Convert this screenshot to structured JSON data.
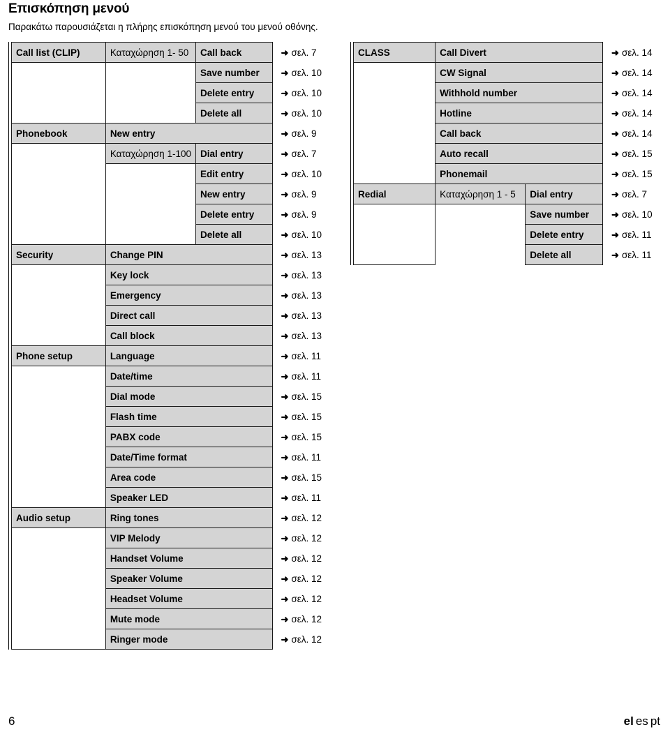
{
  "header": {
    "title": "Επισκόπηση μενού",
    "subtitle": "Παρακάτω παρουσιάζεται η πλήρης επισκόπηση μενού του μενού οθόνης."
  },
  "ref_prefix": "σελ.",
  "arrow_glyph": "➜",
  "colors": {
    "cell_fill": "#d4d4d4",
    "cell_border": "#1a1a1a",
    "text": "#000000",
    "page_bg": "#ffffff"
  },
  "left_table": {
    "rows": [
      {
        "c1": "Call list (CLIP)",
        "c2": "Καταχώρηση 1- 50",
        "c2_style": "reg",
        "c3": "Call back",
        "ref": "7"
      },
      {
        "c1": "",
        "c2": "",
        "c3": "Save number",
        "ref": "10"
      },
      {
        "c1": "",
        "c2": "",
        "c3": "Delete entry",
        "ref": "10"
      },
      {
        "c1": "",
        "c2": "",
        "c3": "Delete all",
        "ref": "10"
      },
      {
        "c1": "Phonebook",
        "c2": "New entry",
        "c2_span": 2,
        "ref": "9"
      },
      {
        "c1": "",
        "c2": "Καταχώρηση 1-100",
        "c2_style": "reg",
        "c3": "Dial entry",
        "ref": "7"
      },
      {
        "c1": "",
        "c2": "",
        "c3": "Edit entry",
        "ref": "10"
      },
      {
        "c1": "",
        "c2": "",
        "c3": "New entry",
        "ref": "9"
      },
      {
        "c1": "",
        "c2": "",
        "c3": "Delete entry",
        "ref": "9"
      },
      {
        "c1": "",
        "c2": "",
        "c3": "Delete all",
        "ref": "10"
      },
      {
        "c1": "Security",
        "c2": "Change PIN",
        "c2_span": 2,
        "ref": "13"
      },
      {
        "c1": "",
        "c2": "Key lock",
        "c2_span": 2,
        "ref": "13"
      },
      {
        "c1": "",
        "c2": "Emergency",
        "c2_span": 2,
        "ref": "13"
      },
      {
        "c1": "",
        "c2": "Direct call",
        "c2_span": 2,
        "ref": "13"
      },
      {
        "c1": "",
        "c2": "Call block",
        "c2_span": 2,
        "ref": "13"
      },
      {
        "c1": "Phone setup",
        "c2": "Language",
        "c2_span": 2,
        "ref": "11"
      },
      {
        "c1": "",
        "c2": "Date/time",
        "c2_span": 2,
        "ref": "11"
      },
      {
        "c1": "",
        "c2": "Dial mode",
        "c2_span": 2,
        "ref": "15"
      },
      {
        "c1": "",
        "c2": "Flash time",
        "c2_span": 2,
        "ref": "15"
      },
      {
        "c1": "",
        "c2": "PABX code",
        "c2_span": 2,
        "ref": "15"
      },
      {
        "c1": "",
        "c2": "Date/Time format",
        "c2_span": 2,
        "ref": "11"
      },
      {
        "c1": "",
        "c2": "Area code",
        "c2_span": 2,
        "ref": "15"
      },
      {
        "c1": "",
        "c2": "Speaker LED",
        "c2_span": 2,
        "ref": "11"
      },
      {
        "c1": "Audio setup",
        "c2": "Ring tones",
        "c2_span": 2,
        "ref": "12"
      },
      {
        "c1": "",
        "c2": "VIP Melody",
        "c2_span": 2,
        "ref": "12"
      },
      {
        "c1": "",
        "c2": "Handset Volume",
        "c2_span": 2,
        "ref": "12"
      },
      {
        "c1": "",
        "c2": "Speaker Volume",
        "c2_span": 2,
        "ref": "12"
      },
      {
        "c1": "",
        "c2": "Headset Volume",
        "c2_span": 2,
        "ref": "12"
      },
      {
        "c1": "",
        "c2": "Mute mode",
        "c2_span": 2,
        "ref": "12"
      },
      {
        "c1": "",
        "c2": "Ringer mode",
        "c2_span": 2,
        "ref": "12"
      }
    ]
  },
  "right_table": {
    "rows": [
      {
        "c1": "CLASS",
        "c2": "Call Divert",
        "c2_span": 2,
        "ref": "14"
      },
      {
        "c1": "",
        "c2": "CW Signal",
        "c2_span": 2,
        "ref": "14"
      },
      {
        "c1": "",
        "c2": "Withhold number",
        "c2_span": 2,
        "ref": "14"
      },
      {
        "c1": "",
        "c2": "Hotline",
        "c2_span": 2,
        "ref": "14"
      },
      {
        "c1": "",
        "c2": "Call back",
        "c2_span": 2,
        "ref": "14"
      },
      {
        "c1": "",
        "c2": "Auto recall",
        "c2_span": 2,
        "ref": "15"
      },
      {
        "c1": "",
        "c2": "Phonemail",
        "c2_span": 2,
        "ref": "15"
      },
      {
        "c1": "Redial",
        "c2": "Καταχώρηση 1 - 5",
        "c2_style": "reg",
        "c3": "Dial entry",
        "ref": "7"
      },
      {
        "c1": "",
        "c2": "",
        "c3": "Save number",
        "ref": "10"
      },
      {
        "c1": "",
        "c2": "",
        "c3": "Delete entry",
        "ref": "11"
      },
      {
        "c1": "",
        "c2": "",
        "c3": "Delete all",
        "ref": "11"
      }
    ]
  },
  "footer": {
    "page_number": "6",
    "current_language": "el",
    "other_languages": [
      "es",
      "pt"
    ]
  }
}
